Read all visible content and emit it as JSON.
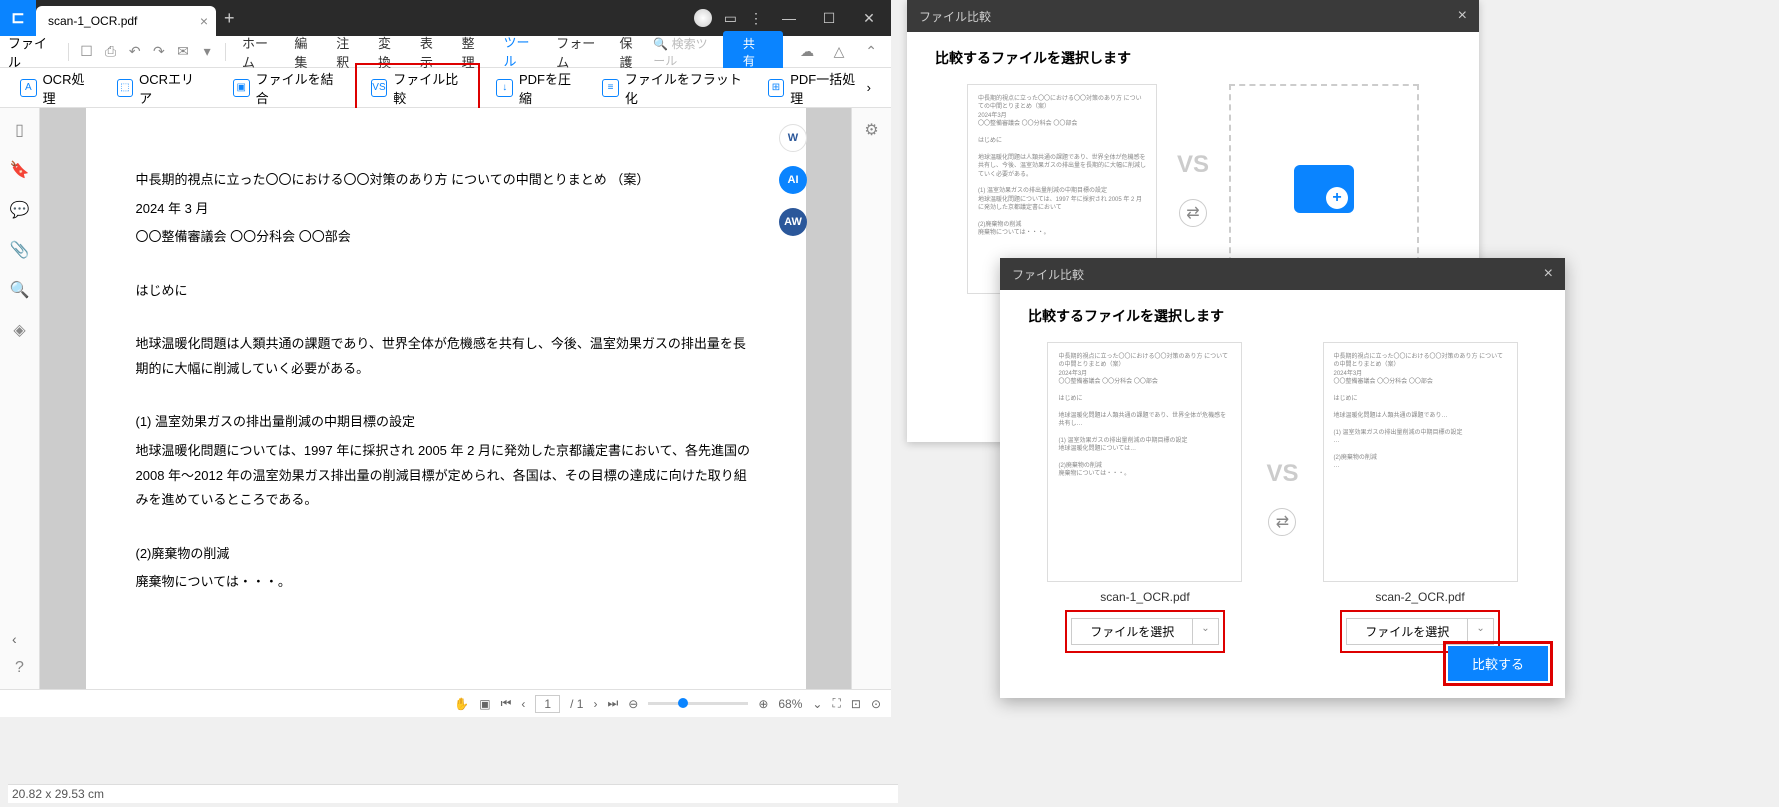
{
  "titlebar": {
    "tab_name": "scan-1_OCR.pdf"
  },
  "menubar": {
    "file": "ファイル",
    "items": [
      "ホーム",
      "編集",
      "注釈",
      "変換",
      "表示",
      "整理",
      "ツール",
      "フォーム",
      "保護"
    ],
    "active_index": 6,
    "search_placeholder": "検索ツール",
    "share": "共有"
  },
  "toolbar": {
    "ocr": "OCR処理",
    "ocr_area": "OCRエリア",
    "combine": "ファイルを結合",
    "compare": "ファイル比較",
    "compress": "PDFを圧縮",
    "flatten": "ファイルをフラット化",
    "batch": "PDF一括処理"
  },
  "document": {
    "title_line": "中長期的視点に立った〇〇における〇〇対策のあり方 についての中間とりまとめ （案）",
    "date": "2024 年 3 月",
    "council": "〇〇整備審議会 〇〇分科会 〇〇部会",
    "intro_h": "はじめに",
    "intro_body": "  地球温暖化問題は人類共通の課題であり、世界全体が危機感を共有し、今後、温室効果ガスの排出量を長期的に大幅に削減していく必要がある。",
    "sec1_h": "(1) 温室効果ガスの排出量削減の中期目標の設定",
    "sec1_body": "  地球温暖化問題については、1997 年に採択され 2005 年 2 月に発効した京都議定書において、各先進国の 2008 年～2012 年の温室効果ガス排出量の削減目標が定められ、各国は、その目標の達成に向けた取り組みを進めているところである。",
    "sec2_h": "(2)廃棄物の削減",
    "sec2_body": "  廃棄物については・・・。"
  },
  "statusbar": {
    "page": "1",
    "total": "/ 1",
    "zoom": "68%",
    "dimensions": "20.82 x 29.53 cm"
  },
  "dialog": {
    "title": "ファイル比較",
    "heading": "比較するファイルを選択します",
    "vs": "VS",
    "file1": "scan-1_OCR.pdf",
    "file2": "scan-2_OCR.pdf",
    "select_label": "ファイルを選択",
    "compare_btn": "比較する"
  }
}
